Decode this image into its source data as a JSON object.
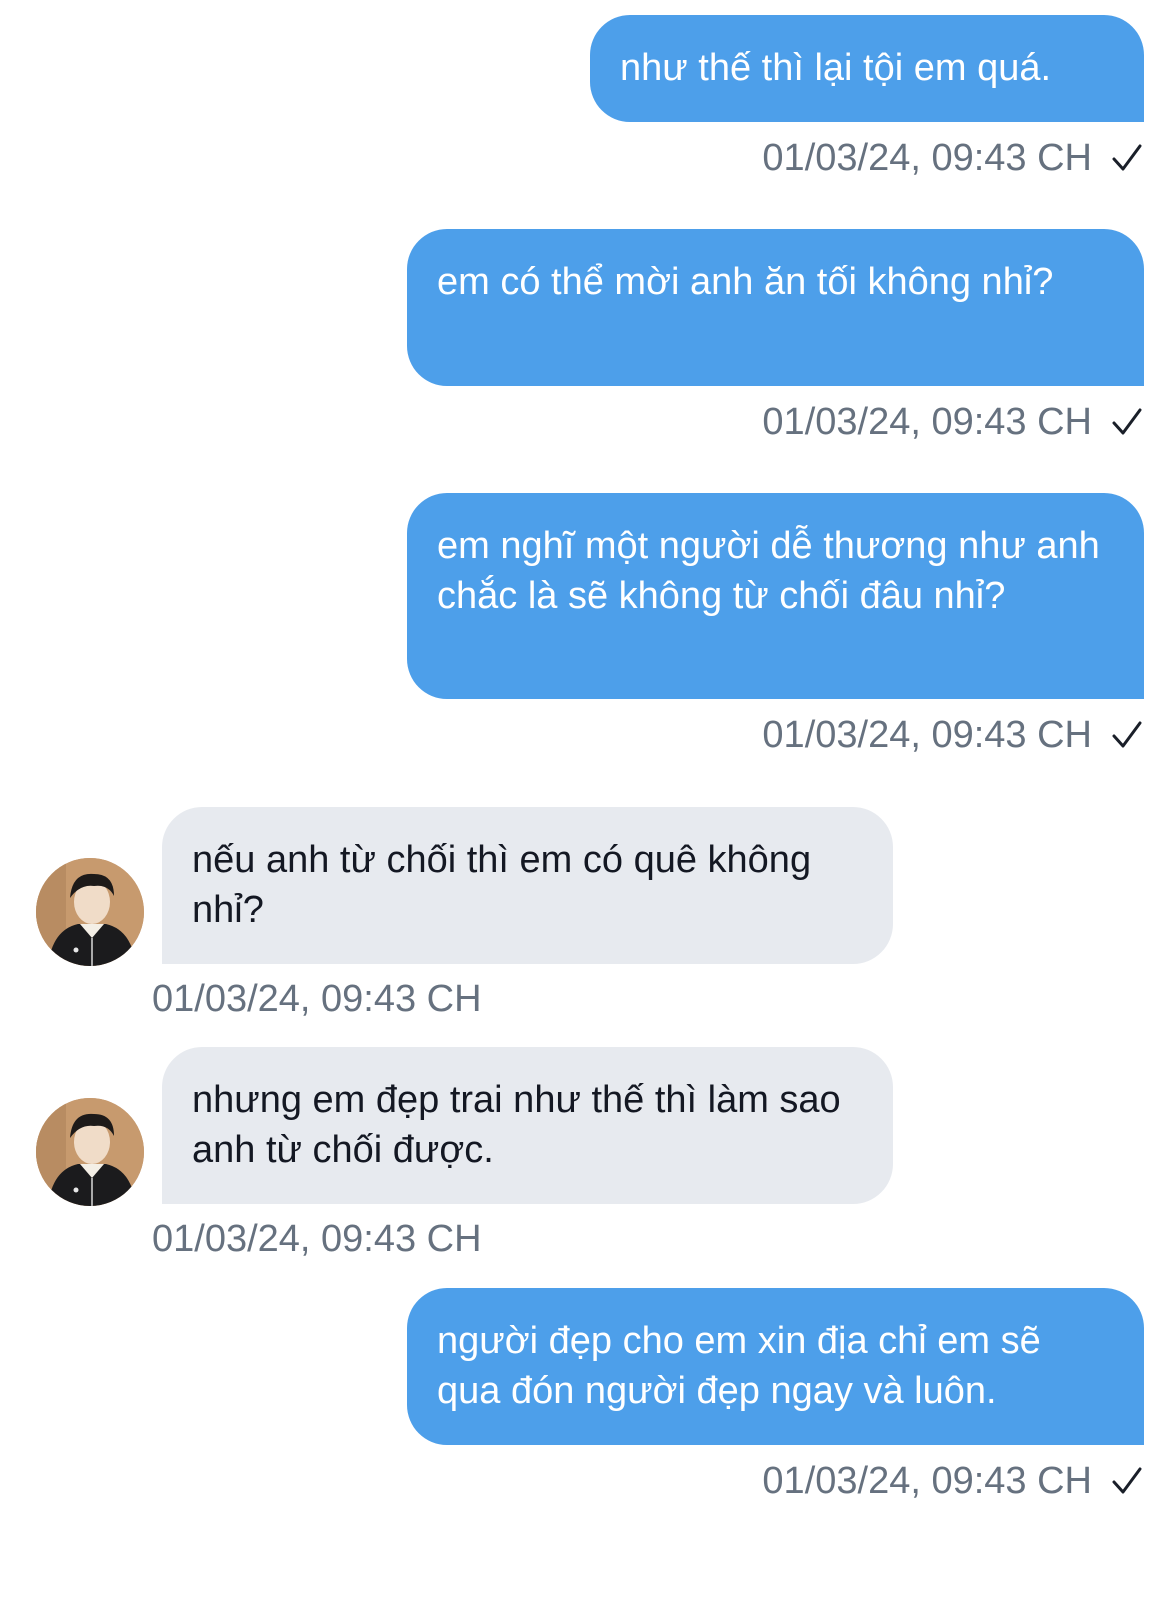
{
  "messages": [
    {
      "direction": "out",
      "text": "như thế thì lại tội em quá.",
      "time": "01/03/24, 09:43 CH",
      "status_icon": "check-icon"
    },
    {
      "direction": "out",
      "text": "em có thể mời anh ăn tối không nhỉ?",
      "time": "01/03/24, 09:43 CH",
      "status_icon": "check-icon"
    },
    {
      "direction": "out",
      "text": "em nghĩ một người dễ thương như anh chắc là sẽ không từ chối đâu nhỉ?",
      "time": "01/03/24, 09:43 CH",
      "status_icon": "check-icon"
    },
    {
      "direction": "in",
      "text": "nếu anh từ chối thì em có quê không nhỉ?",
      "time": "01/03/24, 09:43 CH",
      "avatar_icon": "avatar"
    },
    {
      "direction": "in",
      "text": "nhưng em đẹp trai như thế thì làm sao anh từ chối được.",
      "time": "01/03/24, 09:43 CH",
      "avatar_icon": "avatar"
    },
    {
      "direction": "out",
      "text": "người đẹp cho em xin địa chỉ em sẽ qua đón người đẹp ngay và luôn.",
      "time": "01/03/24, 09:43 CH",
      "status_icon": "check-icon"
    }
  ],
  "colors": {
    "outgoing_bubble": "#4d9fea",
    "incoming_bubble": "#e7eaef",
    "timestamp": "#66717f"
  }
}
